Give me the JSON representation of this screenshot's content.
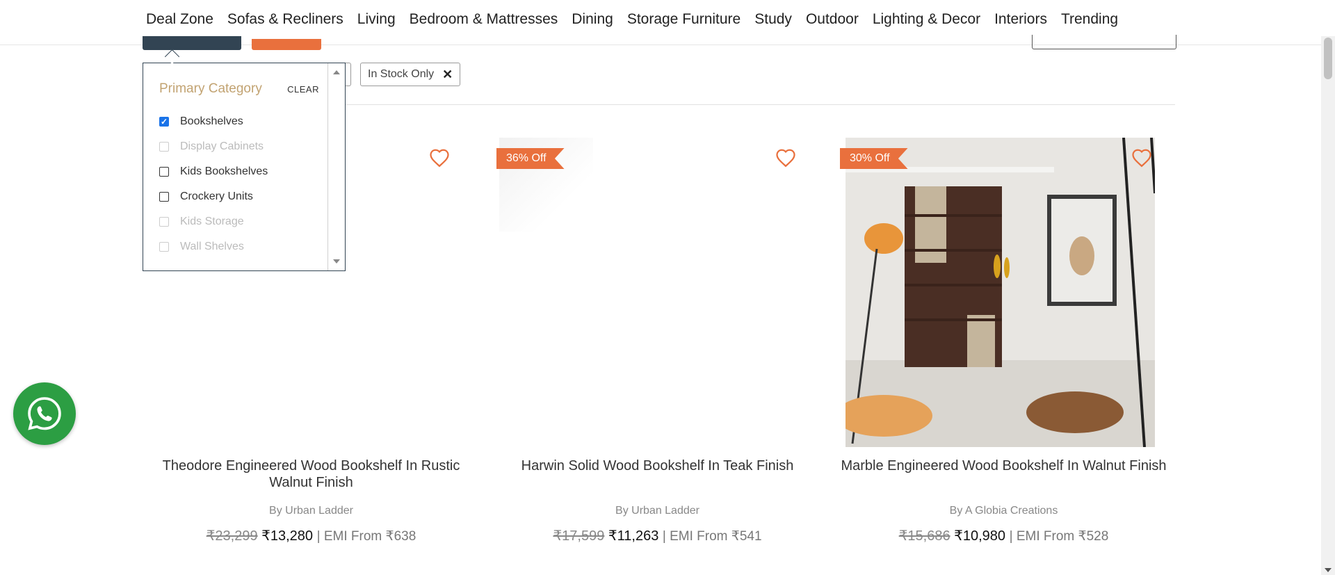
{
  "nav": {
    "items": [
      "Deal Zone",
      "Sofas & Recliners",
      "Living",
      "Bedroom & Mattresses",
      "Dining",
      "Storage Furniture",
      "Study",
      "Outdoor",
      "Lighting & Decor",
      "Interiors",
      "Trending"
    ]
  },
  "chips": {
    "in_stock": "In Stock Only",
    "remove_icon": "✕"
  },
  "filter": {
    "title": "Primary Category",
    "clear_label": "CLEAR",
    "options": [
      {
        "label": "Bookshelves",
        "checked": true,
        "disabled": false
      },
      {
        "label": "Display Cabinets",
        "checked": false,
        "disabled": true
      },
      {
        "label": "Kids Bookshelves",
        "checked": false,
        "disabled": false
      },
      {
        "label": "Crockery Units",
        "checked": false,
        "disabled": false
      },
      {
        "label": "Kids Storage",
        "checked": false,
        "disabled": true
      },
      {
        "label": "Wall Shelves",
        "checked": false,
        "disabled": true
      }
    ]
  },
  "products": [
    {
      "name": "Theodore Engineered Wood Bookshelf In Rustic Walnut Finish",
      "by": "By Urban Ladder",
      "mrp": "₹23,299",
      "price": "₹13,280",
      "emi": "| EMI From ₹638",
      "badge": ""
    },
    {
      "name": "Harwin Solid Wood Bookshelf In Teak Finish",
      "by": "By Urban Ladder",
      "mrp": "₹17,599",
      "price": "₹11,263",
      "emi": "| EMI From ₹541",
      "badge": "36% Off"
    },
    {
      "name": "Marble Engineered Wood Bookshelf In Walnut Finish",
      "by": "By A Globia Creations",
      "mrp": "₹15,686",
      "price": "₹10,980",
      "emi": "| EMI From ₹528",
      "badge": "30% Off"
    }
  ],
  "colors": {
    "accent": "#e9703d",
    "nav_dark": "#324453",
    "filter_title": "#c2a372",
    "whatsapp": "#2c9e43"
  },
  "icons": {
    "wishlist": "heart-icon",
    "whatsapp": "whatsapp-icon"
  }
}
